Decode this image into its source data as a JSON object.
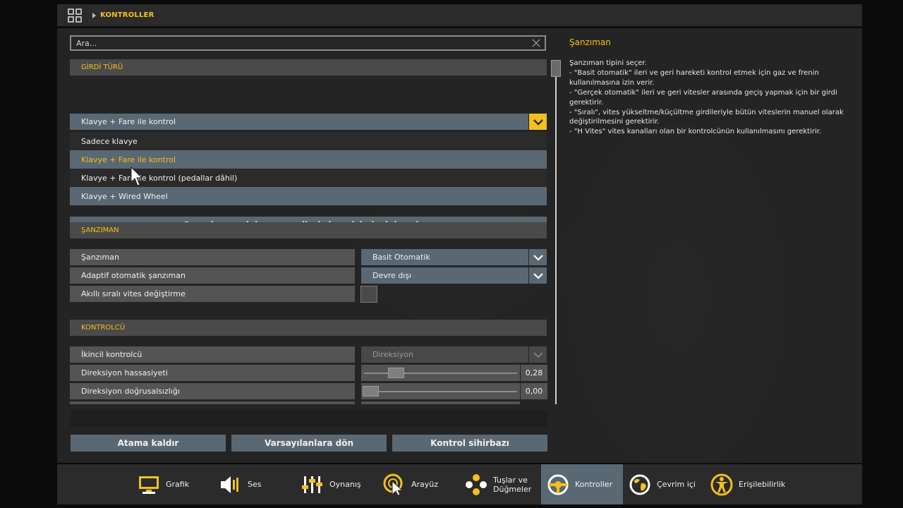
{
  "topbar": {
    "breadcrumb": "KONTROLLER",
    "accent_color": "#f4c01b"
  },
  "search": {
    "placeholder": "Ara..."
  },
  "input_type": {
    "section_title": "GİRDİ TÜRÜ",
    "selected": "Klavye + Fare ile kontrol",
    "options": [
      "Sadece klavye",
      "Klavye + Fare ile kontrol",
      "Klavye + Fare ile kontrol (pedallar dâhil)",
      "Klavye + Wired Wheel"
    ],
    "quick_setup_label": "Oyun kumandaları veya direksiyon için hızlı kurulum"
  },
  "transmission": {
    "section_title": "ŞANZIMAN",
    "rows": [
      {
        "label": "Şanzıman",
        "value": "Basit Otomatik"
      },
      {
        "label": "Adaptif otomatik şanzıman",
        "value": "Devre dışı"
      },
      {
        "label": "Akıllı sıralı vites değiştirme"
      }
    ]
  },
  "controller": {
    "section_title": "KONTROLCÜ",
    "secondary": {
      "label": "İkincil kontrolcü",
      "value": "Direksiyon"
    },
    "sensitivity": {
      "label": "Direksiyon hassasiyeti",
      "value": "0,28",
      "level": 0.28
    },
    "linearity": {
      "label": "Direksiyon doğrusalsızlığı",
      "value": "0,00",
      "level": 0.0
    }
  },
  "actions": {
    "unbind": "Atama kaldır",
    "defaults": "Varsayılanlara dön",
    "wizard": "Kontrol sihirbazı"
  },
  "info": {
    "title": "Şanzıman",
    "lines": [
      "Şanzıman tipini seçer.",
      "- \"Basit otomatik\" ileri ve geri hareketi kontrol etmek için gaz ve frenin kullanılmasına izin verir.",
      "- \"Gerçek otomatik\" ileri ve geri vitesler arasında geçiş yapmak için bir girdi gerektirir.",
      "- \"Sıralı\", vites yükseltme/küçültme girdileriyle bütün viteslerin manuel olarak değiştirilmesini gerektirir.",
      "- \"H Vites\" vites kanalları olan bir kontrolcünün kullanılmasını gerektirir."
    ]
  },
  "nav": {
    "items": [
      {
        "label": "Grafik",
        "icon": "monitor-icon"
      },
      {
        "label": "Ses",
        "icon": "speaker-icon"
      },
      {
        "label": "Oynanış",
        "icon": "sliders-icon"
      },
      {
        "label": "Arayüz",
        "icon": "cursor-target-icon"
      },
      {
        "label": "Tuşlar ve Düğmeler",
        "icon": "gamepad-buttons-icon"
      },
      {
        "label": "Kontroller",
        "icon": "steering-wheel-icon"
      },
      {
        "label": "Çevrim içi",
        "icon": "globe-icon"
      },
      {
        "label": "Erişilebilirlik",
        "icon": "accessibility-icon"
      }
    ],
    "active": "Kontroller"
  }
}
